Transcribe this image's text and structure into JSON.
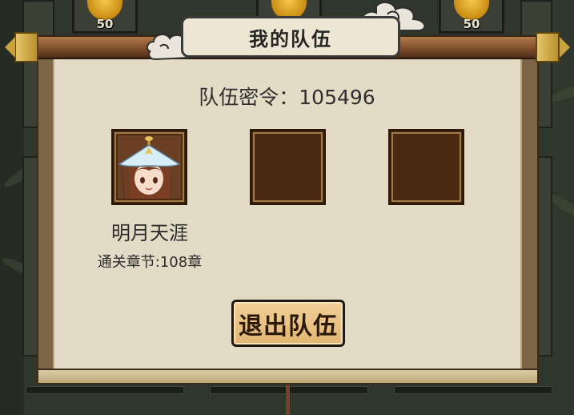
{
  "background": {
    "top_slots": [
      {
        "value": "50",
        "icon": "gold-ingot-icon"
      },
      {
        "value": "",
        "icon": "gold-ingot-icon"
      },
      {
        "value": "50",
        "icon": "gold-ingot-icon"
      }
    ]
  },
  "panel": {
    "title": "我的队伍",
    "team_code_label": "队伍密令：",
    "team_code_value": "105496"
  },
  "members": [
    {
      "name": "明月天涯",
      "progress": "通关章节:108章",
      "occupied": true
    },
    {
      "name": "",
      "progress": "",
      "occupied": false
    },
    {
      "name": "",
      "progress": "",
      "occupied": false
    }
  ],
  "actions": {
    "leave_label": "退出队伍"
  },
  "colors": {
    "panel_bg": "#e4dbc6",
    "slot_bg": "#4a2b12",
    "button_bg": "#e8be7e",
    "rod": "#7a4a2a",
    "rod_cap": "#d4b050"
  }
}
